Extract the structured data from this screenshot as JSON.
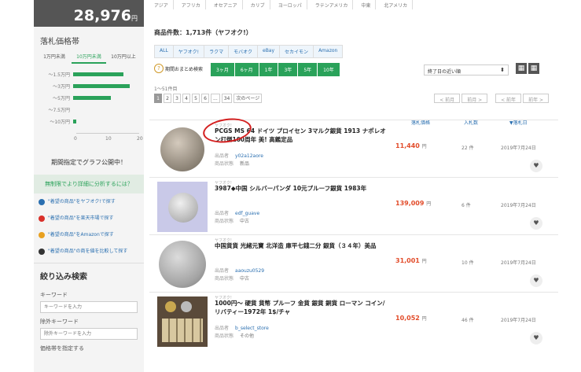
{
  "sidebar": {
    "total_value": "28,976",
    "total_unit": "円",
    "distribution_heading": "落札価格帯",
    "range_tabs": [
      "1万円未満",
      "10万円未満",
      "10万円以上"
    ],
    "chart_data": {
      "type": "bar",
      "orientation": "horizontal",
      "categories": [
        "〜1.5万円",
        "〜3万円",
        "〜5万円",
        "〜7.5万円",
        "〜10万円"
      ],
      "values": [
        16,
        18,
        12,
        0,
        1
      ],
      "xlim": [
        0,
        20
      ],
      "xticks": [
        "0",
        "10",
        "20"
      ],
      "bar_color": "#2aa25a"
    },
    "chart_note": "期間指定でグラフ公開中！",
    "premium_link": "無制限でより詳細に分析するには？",
    "links": [
      {
        "text": "\"着望の商品\"をヤフオク!で探す",
        "color": "#2a6fb0"
      },
      {
        "text": "\"着望の商品\"を楽天市場で探す",
        "color": "#d9302a"
      },
      {
        "text": "\"着望の商品\"をAmazonで探す",
        "color": "#e8a020"
      },
      {
        "text": "\"着望の商品\"の商を値を比較して探す",
        "color": "#333333"
      }
    ],
    "narrow_heading": "絞り込み検索",
    "keyword_label": "キーワード",
    "keyword_placeholder": "キーワードを入力",
    "exclude_label": "除外キーワード",
    "exclude_placeholder": "除外キーワードを入力",
    "price_label": "価格帯を指定する"
  },
  "main": {
    "regions": [
      "アジア",
      "アフリカ",
      "オセアニア",
      "カリブ",
      "ヨーロッパ",
      "ラテンアメリカ",
      "中東",
      "北アメリカ"
    ],
    "result_count": "商品件数：1,713件（ヤフオク!）",
    "store_tabs": [
      "ALL",
      "ヤフオク!",
      "ラクマ",
      "モバオク",
      "eBay",
      "セカイモン",
      "Amazon"
    ],
    "period_label": "期間おまとめ検索",
    "periods": [
      "3ヶ月",
      "6ヶ月",
      "1年",
      "3年",
      "5年",
      "10年"
    ],
    "sort_value": "終了日の近い順",
    "range_label": "1〜51件目",
    "pages": [
      "1",
      "2",
      "3",
      "4",
      "5",
      "6",
      "...",
      "34",
      "次のページ"
    ],
    "prev_label": "< 前月",
    "next_label": "前月 >",
    "prev2_label": "< 前年",
    "next2_label": "前年 >",
    "columns": {
      "price": "落札価格",
      "bids": "入札数",
      "date": "▼落札日"
    },
    "price_unit": "円",
    "bids_unit": "件",
    "items": [
      {
        "platform": "ヤフオク!",
        "title": "PCGS MS 64 ドイツ プロイセン 3マルク銀貨 1913 ナポレオン打倒100周年 美! 高鑑定品",
        "seller_label": "出品者",
        "seller": "y02a12aore",
        "condition_label": "商品状態",
        "condition": "新品",
        "price": "11,440",
        "bids": "22",
        "date": "2019年7月24日"
      },
      {
        "platform": "ヤフオク!",
        "title": "3987◆中国 シルバーパンダ 10元プルーフ銀貨 1983年",
        "seller_label": "出品者",
        "seller": "edf_guave",
        "condition_label": "商品状態",
        "condition": "中古",
        "price": "139,009",
        "bids": "6",
        "date": "2019年7月24日"
      },
      {
        "platform": "ヤフオク!",
        "title": "中国貨貨 光緒元寶 北洋造 庫平七錢二分 銀貨（３４年）美品",
        "seller_label": "出品者",
        "seller": "aaouzu0529",
        "condition_label": "商品状態",
        "condition": "中古",
        "price": "31,001",
        "bids": "10",
        "date": "2019年7月24日"
      },
      {
        "platform": "ヤフオク!",
        "title": "1000円〜 硬貨 貨幣 プルーフ 金貨 銀貨 銅貨 ローマン コイン/リバティー1972年 1$/チャ",
        "seller_label": "出品者",
        "seller": "b_select_store",
        "condition_label": "商品状態",
        "condition": "その他",
        "price": "10,052",
        "bids": "46",
        "date": "2019年7月24日"
      }
    ]
  }
}
